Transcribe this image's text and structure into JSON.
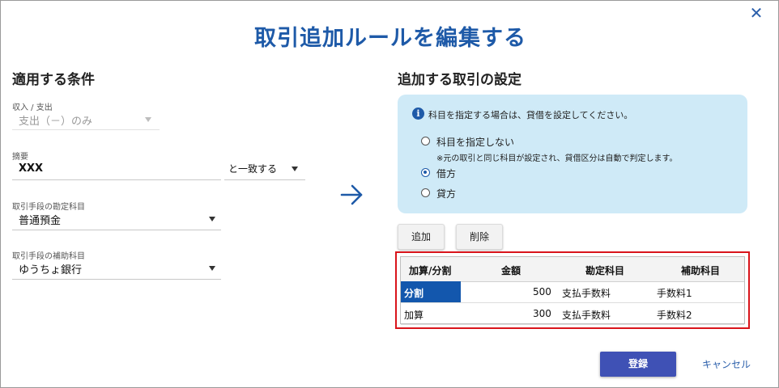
{
  "dialog": {
    "title": "取引追加ルールを編集する",
    "close_icon": "close-icon"
  },
  "left": {
    "section_title": "適用する条件",
    "income_expense": {
      "label": "収入 / 支出",
      "value": "支出（－）のみ",
      "disabled": true
    },
    "summary": {
      "label": "摘要",
      "value": "XXX",
      "match_value": "と一致する"
    },
    "account": {
      "label": "取引手段の勘定科目",
      "value": "普通預金"
    },
    "sub_account": {
      "label": "取引手段の補助科目",
      "value": "ゆうちょ銀行"
    }
  },
  "arrow_icon": "arrow-right-icon",
  "right": {
    "section_title": "追加する取引の設定",
    "info": {
      "icon": "info-icon",
      "text": "科目を指定する場合は、貸借を設定してください。",
      "options": [
        {
          "label": "科目を指定しない",
          "checked": false,
          "note": "※元の取引と同じ科目が設定され、貸借区分は自動で判定します。"
        },
        {
          "label": "借方",
          "checked": true
        },
        {
          "label": "貸方",
          "checked": false
        }
      ]
    },
    "buttons": {
      "add": "追加",
      "delete": "削除"
    },
    "table": {
      "headers": [
        "加算/分割",
        "金額",
        "勘定科目",
        "補助科目"
      ],
      "rows": [
        {
          "type": "分割",
          "amount": "500",
          "account": "支払手数料",
          "sub": "手数料1",
          "selected": true
        },
        {
          "type": "加算",
          "amount": "300",
          "account": "支払手数料",
          "sub": "手数料2",
          "selected": false
        }
      ],
      "highlight_color": "#d9141b"
    }
  },
  "footer": {
    "register": "登録",
    "cancel": "キャンセル"
  },
  "colors": {
    "accent": "#1e5aa8",
    "primary_button": "#3f51b5",
    "info_bg": "#cfeaf7",
    "selected_cell": "#1357ad"
  }
}
